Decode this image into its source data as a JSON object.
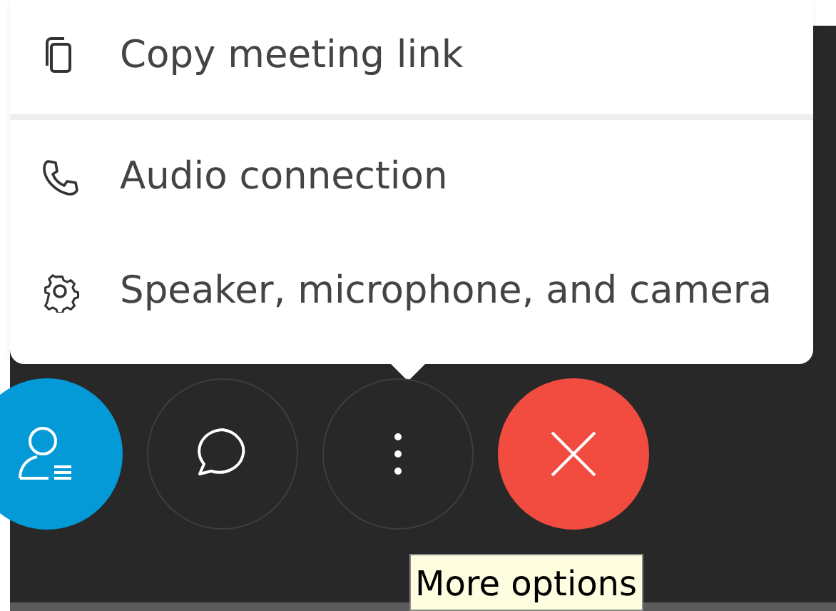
{
  "menu": {
    "sections": [
      [
        {
          "kind": "copy",
          "label": "Copy meeting link"
        }
      ],
      [
        {
          "kind": "phone",
          "label": "Audio connection"
        },
        {
          "kind": "gear",
          "label": "Speaker, microphone, and camera"
        }
      ]
    ]
  },
  "toolbar": [
    {
      "kind": "participants"
    },
    {
      "kind": "chat"
    },
    {
      "kind": "more"
    },
    {
      "kind": "leave"
    }
  ],
  "tooltip": "More options"
}
